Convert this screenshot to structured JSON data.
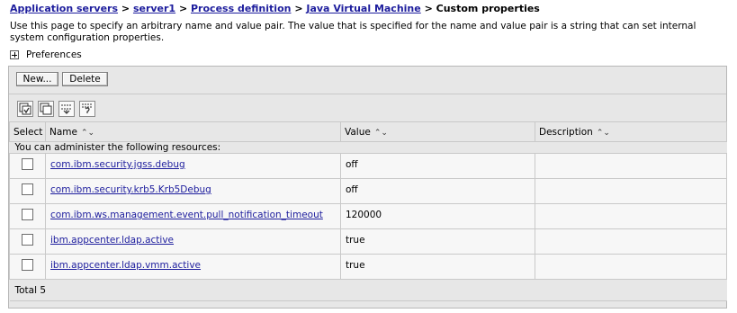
{
  "breadcrumb": {
    "items": [
      "Application servers",
      "server1",
      "Process definition",
      "Java Virtual Machine"
    ],
    "current": "Custom properties",
    "separator": ">"
  },
  "description": "Use this page to specify an arbitrary name and value pair. The value that is specified for the name and value pair is a string that can set internal system configuration properties.",
  "preferences_label": "Preferences",
  "buttons": {
    "new": "New...",
    "delete": "Delete"
  },
  "toolbar_icons": [
    "select-all-icon",
    "deselect-all-icon",
    "expand-icon",
    "filter-icon"
  ],
  "table": {
    "headers": {
      "select": "Select",
      "name": "Name",
      "value": "Value",
      "description": "Description"
    },
    "group_label": "You can administer the following resources:",
    "rows": [
      {
        "name": "com.ibm.security.jgss.debug",
        "value": "off",
        "description": ""
      },
      {
        "name": "com.ibm.security.krb5.Krb5Debug",
        "value": "off",
        "description": ""
      },
      {
        "name": "com.ibm.ws.management.event.pull_notification_timeout",
        "value": "120000",
        "description": ""
      },
      {
        "name": "ibm.appcenter.ldap.active",
        "value": "true",
        "description": ""
      },
      {
        "name": "ibm.appcenter.ldap.vmm.active",
        "value": "true",
        "description": ""
      }
    ],
    "total": "Total 5"
  },
  "colors": {
    "link": "#1d1d9d",
    "panel_bg": "#e7e7e7",
    "row_bg": "#f7f7f7"
  }
}
